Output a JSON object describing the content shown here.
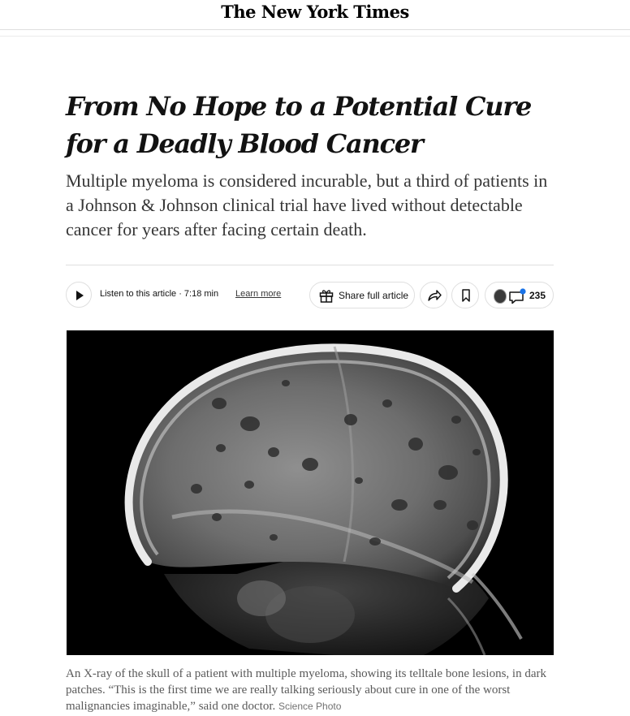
{
  "masthead": {
    "logo": "The New York Times"
  },
  "article": {
    "headline": "From No Hope to a Potential Cure for a Deadly Blood Cancer",
    "summary": "Multiple myeloma is considered incurable, but a third of patients in a Johnson & Johnson clinical trial have lived without detectable cancer for years after facing certain death."
  },
  "toolbar": {
    "listen_label": "Listen to this article · 7:18 min",
    "learn_more": "Learn more",
    "share_full_label": "Share full article",
    "comment_count": "235"
  },
  "figure": {
    "caption": "An X-ray of the skull of a patient with multiple myeloma, showing its telltale bone lesions, in dark patches. “This is the first time we are really talking seriously about cure in one of the worst malignancies imaginable,” said one doctor.",
    "credit": "Science Photo"
  },
  "icons": {
    "play": "play-icon",
    "gift": "gift-icon",
    "share": "share-arrow-icon",
    "bookmark": "bookmark-icon",
    "comment": "comment-bubble-icon"
  },
  "colors": {
    "text": "#121212",
    "summary": "#363636",
    "caption": "#5a5a5a",
    "border": "#dfdfdf",
    "notify_dot": "#1a73e8"
  }
}
